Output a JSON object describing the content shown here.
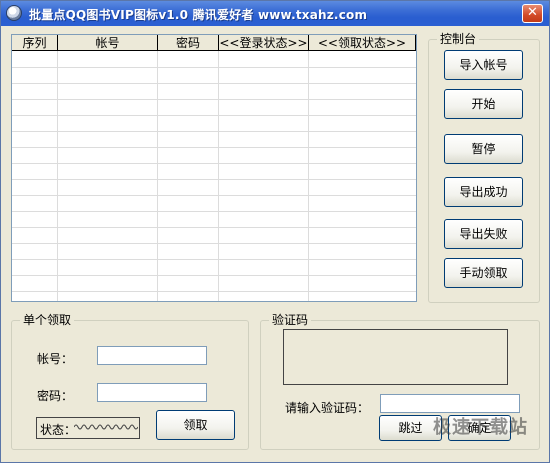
{
  "window": {
    "title": "批量点QQ图书VIP图标v1.0 腾讯爱好者 www.txahz.com",
    "close_label": "✕"
  },
  "grid": {
    "columns": [
      "序列",
      "帐号",
      "密码",
      "<<登录状态>>",
      "<<领取状态>>"
    ],
    "rows": []
  },
  "control_panel": {
    "title": "控制台",
    "buttons": {
      "import": "导入帐号",
      "start": "开始",
      "pause": "暂停",
      "export_success": "导出成功",
      "export_fail": "导出失败",
      "manual_claim": "手动领取"
    }
  },
  "single_claim": {
    "title": "单个领取",
    "account_label": "帐号：",
    "account_value": "",
    "password_label": "密码：",
    "password_value": "",
    "status_label": "状态：",
    "claim_button": "领取"
  },
  "captcha": {
    "title": "验证码",
    "input_label": "请输入验证码：",
    "input_value": "",
    "skip_button": "跳过",
    "confirm_button": "确定"
  },
  "watermark": "极速下载站"
}
